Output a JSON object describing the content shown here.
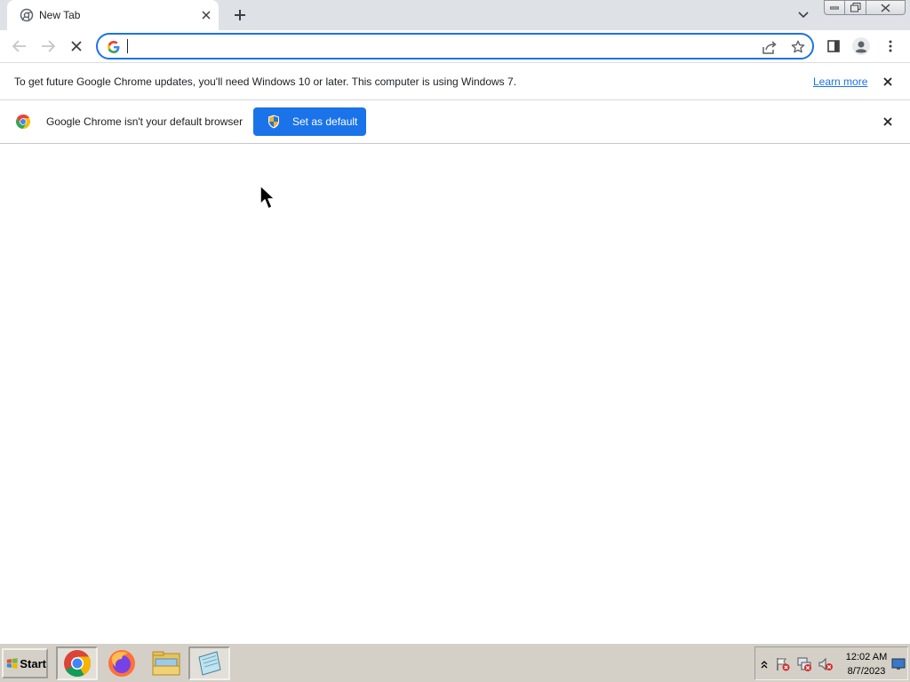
{
  "tab": {
    "title": "New Tab"
  },
  "omnibox": {
    "value": "",
    "placeholder": ""
  },
  "infobar_update": {
    "message": "To get future Google Chrome updates, you'll need Windows 10 or later. This computer is using Windows 7.",
    "link_label": "Learn more"
  },
  "infobar_default": {
    "message": "Google Chrome isn't your default browser",
    "button_label": "Set as default"
  },
  "taskbar": {
    "start_label": "Start",
    "apps": [
      "chrome-icon",
      "firefox-icon",
      "file-explorer-icon",
      "notepad-icon"
    ],
    "clock": {
      "time": "12:02 AM",
      "date": "8/7/2023"
    }
  },
  "colors": {
    "accent": "#1a73e8",
    "tabstrip": "#dee1e6",
    "taskbar": "#d4d0c8"
  }
}
